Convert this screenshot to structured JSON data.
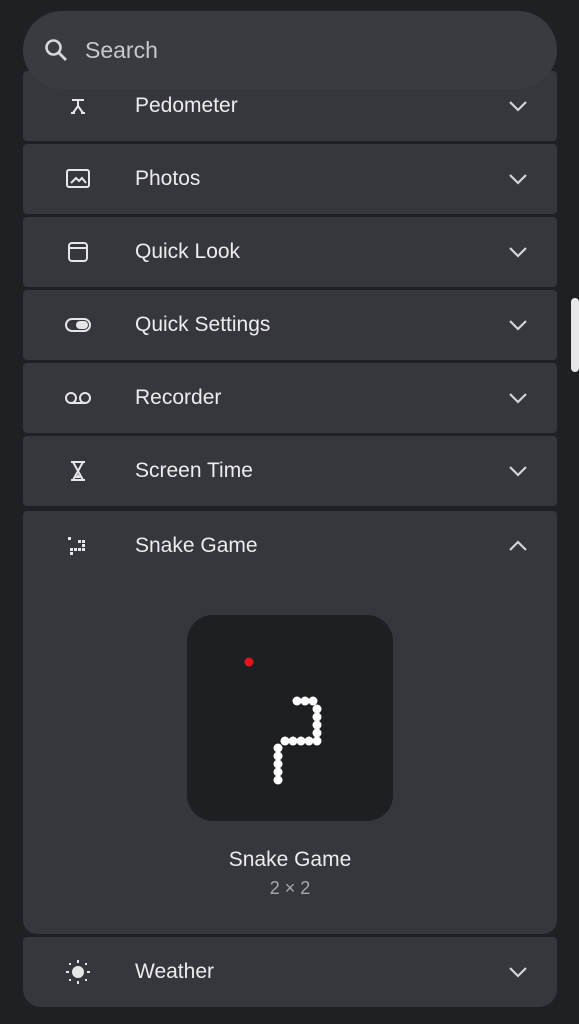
{
  "search": {
    "placeholder": "Search",
    "icon": "search-icon"
  },
  "rows": [
    {
      "label": "Pedometer",
      "icon": "pedometer-icon"
    },
    {
      "label": "Photos",
      "icon": "photos-icon"
    },
    {
      "label": "Quick Look",
      "icon": "quick-look-icon"
    },
    {
      "label": "Quick Settings",
      "icon": "quick-settings-icon"
    },
    {
      "label": "Recorder",
      "icon": "recorder-icon"
    },
    {
      "label": "Screen Time",
      "icon": "hourglass-icon"
    }
  ],
  "expanded": {
    "label": "Snake Game",
    "icon": "snake-game-icon",
    "widget_name": "Snake Game",
    "widget_size": "2 × 2",
    "snake_color": "#ffffff",
    "food_color": "#e0161c"
  },
  "last_row": {
    "label": "Weather",
    "icon": "weather-icon"
  },
  "colors": {
    "background": "#1f2023",
    "row": "#36373c",
    "search": "#3a3b40",
    "text": "#ececee"
  }
}
